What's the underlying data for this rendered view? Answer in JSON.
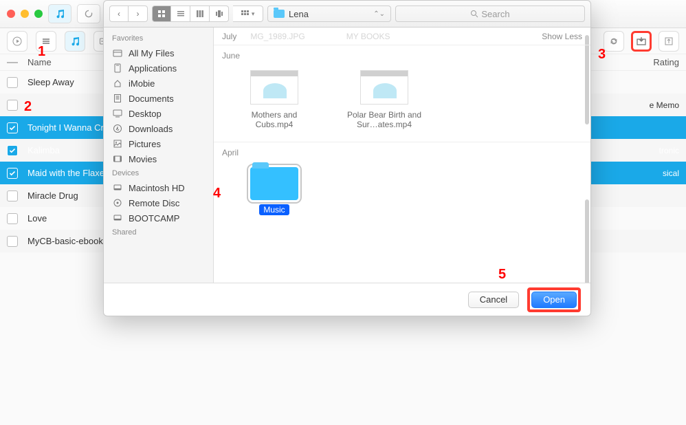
{
  "steps": {
    "s1": "1",
    "s2": "2",
    "s3": "3",
    "s4": "4",
    "s5": "5"
  },
  "table": {
    "header_name": "Name",
    "header_rating": "Rating",
    "rows": [
      {
        "name": "Sleep Away",
        "sel": false,
        "right": ""
      },
      {
        "name": "",
        "sel": false,
        "right": "e Memo",
        "blur": true
      },
      {
        "name": "Tonight I Wanna Cry",
        "sel": true,
        "right": ""
      },
      {
        "name": "Kalimba",
        "sel": true,
        "right": "tronic"
      },
      {
        "name": "Maid with the Flaxen",
        "sel": true,
        "right": "sical"
      },
      {
        "name": "Miracle Drug",
        "sel": false,
        "right": ""
      },
      {
        "name": "Love",
        "sel": false,
        "right": ""
      },
      {
        "name": "MyCB-basic-ebook",
        "sel": false,
        "right": ""
      }
    ]
  },
  "dialog": {
    "path_folder": "Lena",
    "search_placeholder": "Search",
    "sidebar": {
      "favorites_header": "Favorites",
      "devices_header": "Devices",
      "shared_header": "Shared",
      "fav": [
        "All My Files",
        "Applications",
        "iMobie",
        "Documents",
        "Desktop",
        "Downloads",
        "Pictures",
        "Movies"
      ],
      "dev": [
        "Macintosh HD",
        "Remote Disc",
        "BOOTCAMP"
      ]
    },
    "months": {
      "july": "July",
      "july_ghost1": "MG_1989.JPG",
      "july_ghost2": "MY BOOKS",
      "showless": "Show Less",
      "june": "June",
      "april": "April"
    },
    "june_items": [
      {
        "name": "Mothers and Cubs.mp4"
      },
      {
        "name": "Polar Bear Birth and Sur…ates.mp4"
      }
    ],
    "april_item": {
      "name": "Music"
    },
    "cancel": "Cancel",
    "open": "Open"
  }
}
